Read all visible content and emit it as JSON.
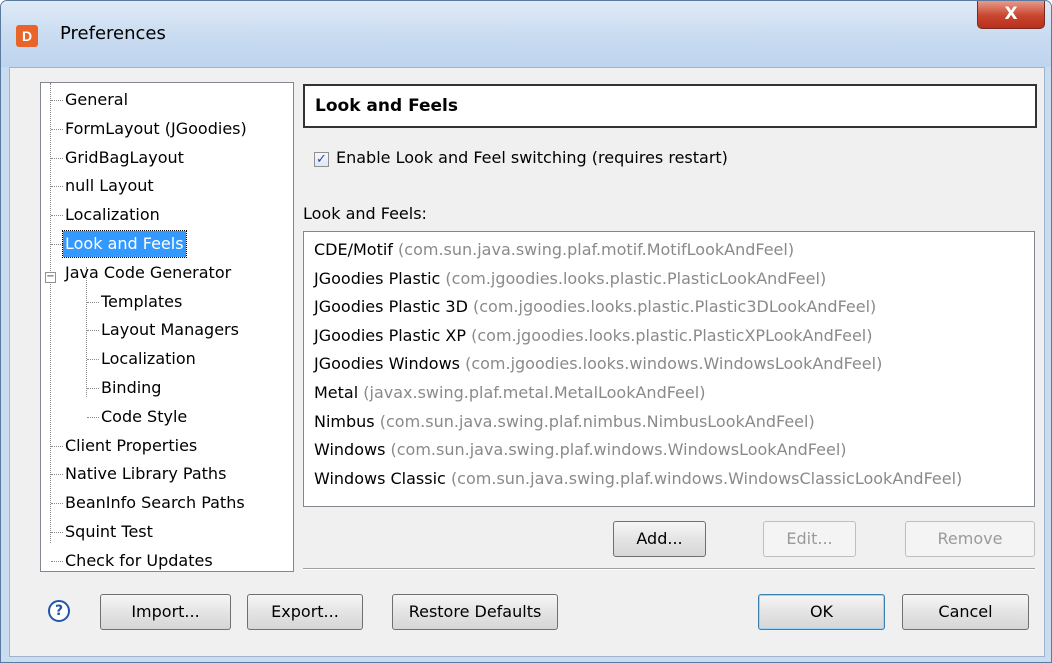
{
  "window": {
    "title": "Preferences",
    "app_icon": "jformdesigner-icon",
    "close_glyph": "X"
  },
  "tree": {
    "items": [
      {
        "label": "General"
      },
      {
        "label": "FormLayout (JGoodies)"
      },
      {
        "label": "GridBagLayout"
      },
      {
        "label": "null Layout"
      },
      {
        "label": "Localization"
      },
      {
        "label": "Look and Feels",
        "selected": true
      },
      {
        "label": "Java Code Generator",
        "expanded": true
      },
      {
        "label": "Templates"
      },
      {
        "label": "Layout Managers"
      },
      {
        "label": "Localization"
      },
      {
        "label": "Binding"
      },
      {
        "label": "Code Style"
      },
      {
        "label": "Client Properties"
      },
      {
        "label": "Native Library Paths"
      },
      {
        "label": "BeanInfo Search Paths"
      },
      {
        "label": "Squint Test"
      },
      {
        "label": "Check for Updates"
      }
    ],
    "expander_glyph": "−"
  },
  "panel": {
    "header": "Look and Feels",
    "enable_checkbox": {
      "checked": true,
      "label": "Enable Look and Feel switching (requires restart)"
    },
    "list_label": "Look and Feels:",
    "look_and_feels": [
      {
        "name": "CDE/Motif",
        "class": "(com.sun.java.swing.plaf.motif.MotifLookAndFeel)"
      },
      {
        "name": "JGoodies Plastic",
        "class": "(com.jgoodies.looks.plastic.PlasticLookAndFeel)"
      },
      {
        "name": "JGoodies Plastic 3D",
        "class": "(com.jgoodies.looks.plastic.Plastic3DLookAndFeel)"
      },
      {
        "name": "JGoodies Plastic XP",
        "class": "(com.jgoodies.looks.plastic.PlasticXPLookAndFeel)"
      },
      {
        "name": "JGoodies Windows",
        "class": "(com.jgoodies.looks.windows.WindowsLookAndFeel)"
      },
      {
        "name": "Metal",
        "class": "(javax.swing.plaf.metal.MetalLookAndFeel)"
      },
      {
        "name": "Nimbus",
        "class": "(com.sun.java.swing.plaf.nimbus.NimbusLookAndFeel)"
      },
      {
        "name": "Windows",
        "class": "(com.sun.java.swing.plaf.windows.WindowsLookAndFeel)"
      },
      {
        "name": "Windows Classic",
        "class": "(com.sun.java.swing.plaf.windows.WindowsClassicLookAndFeel)"
      }
    ],
    "buttons": {
      "add": "Add...",
      "edit": "Edit...",
      "remove": "Remove"
    }
  },
  "footer": {
    "help_glyph": "?",
    "import": "Import...",
    "export": "Export...",
    "restore": "Restore Defaults",
    "ok": "OK",
    "cancel": "Cancel"
  },
  "colors": {
    "selection": "#3399ff",
    "close_button": "#c8452e",
    "help_icon": "#2456a8"
  }
}
